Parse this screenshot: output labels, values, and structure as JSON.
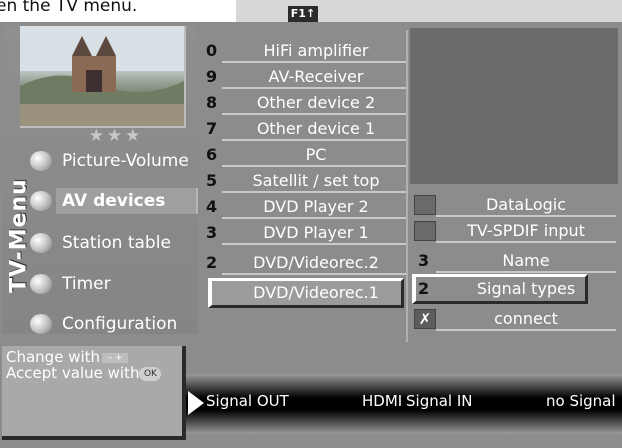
{
  "caption": "en the TV menu.",
  "top_key": "F1",
  "top_key_symbol": "↑",
  "stars": "★★★",
  "menu_title": "TV-Menu",
  "menu": [
    {
      "label": "Picture-Volume",
      "selected": false
    },
    {
      "label": "AV devices",
      "selected": true
    },
    {
      "label": "Station table",
      "selected": false
    },
    {
      "label": "Timer",
      "selected": false
    },
    {
      "label": "Configuration",
      "selected": false
    }
  ],
  "devices": [
    {
      "num": "0",
      "label": "HiFi amplifier"
    },
    {
      "num": "9",
      "label": "AV-Receiver"
    },
    {
      "num": "8",
      "label": "Other device 2"
    },
    {
      "num": "7",
      "label": "Other device 1"
    },
    {
      "num": "6",
      "label": "PC"
    },
    {
      "num": "5",
      "label": "Satellit / set top"
    },
    {
      "num": "4",
      "label": "DVD Player 2"
    },
    {
      "num": "3",
      "label": "DVD Player 1"
    },
    {
      "num": "2",
      "label": "DVD/Videorec.2"
    },
    {
      "num": "",
      "label": "DVD/Videorec.1"
    }
  ],
  "options": [
    {
      "prefix": "",
      "label": "DataLogic"
    },
    {
      "prefix": "",
      "label": "TV-SPDIF input"
    },
    {
      "prefix": "3",
      "label": "Name"
    },
    {
      "prefix": "2",
      "label": "Signal types"
    },
    {
      "prefix": "✗",
      "label": "connect"
    }
  ],
  "help": {
    "line1": "Change with",
    "line2": "Accept value with",
    "minus_plus": "– +",
    "ok": "OK"
  },
  "status": {
    "signal_out_label": "Signal OUT",
    "signal_out_value": "HDMI",
    "signal_in_label": "Signal IN",
    "signal_in_value": "no Signal"
  }
}
